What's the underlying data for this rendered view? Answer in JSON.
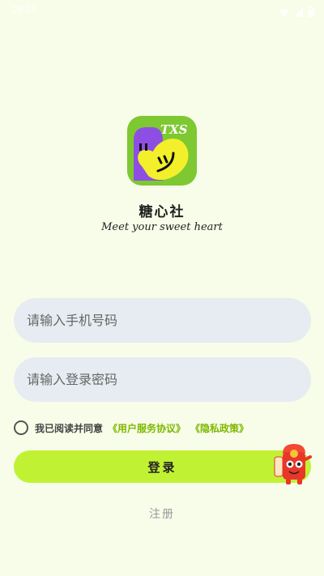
{
  "status_bar": {
    "time": "10:14"
  },
  "app": {
    "logo_text": "TXS",
    "name": "糖心社",
    "slogan": "Meet your sweet heart"
  },
  "login_form": {
    "phone_placeholder": "请输入手机号码",
    "password_placeholder": "请输入登录密码",
    "agreement_prefix": "我已阅读并同意",
    "user_agreement_link": "《用户服务协议》",
    "privacy_policy_link": "《隐私政策》",
    "login_label": "登录",
    "register_label": "注册"
  },
  "colors": {
    "background": "#f8fde9",
    "accent": "#c0f233",
    "link": "#7fb800",
    "input_bg": "#e6ecf1",
    "logo_green": "#7ec832",
    "logo_purple": "#8d4fe3",
    "logo_yellow": "#f3f02b"
  },
  "icons": {
    "wifi": "wifi-icon",
    "signal": "signal-icon",
    "battery": "battery-icon",
    "radio": "radio-unchecked-icon",
    "mascot": "red-envelope-mascot-icon"
  }
}
